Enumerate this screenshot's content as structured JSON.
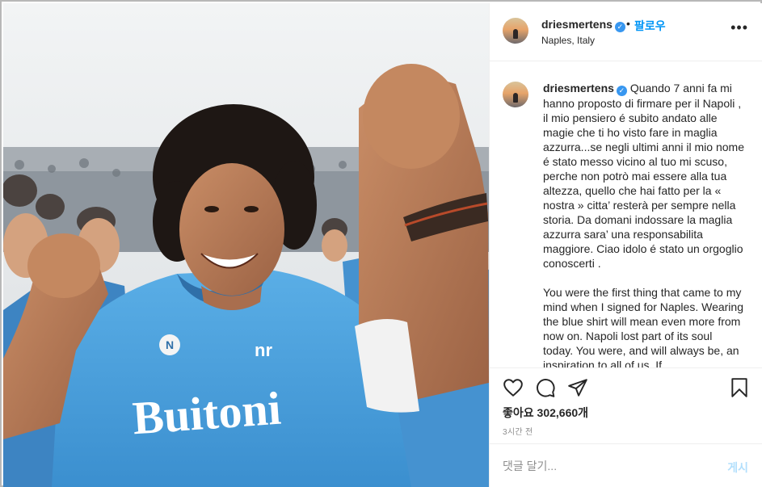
{
  "post": {
    "image_alt": "Diego Maradona celebrating in a Napoli Buitoni jersey",
    "jersey_text": "Buitoni"
  },
  "header": {
    "username": "driesmertens",
    "verified_mark": "✓",
    "dot": "•",
    "follow_label": "팔로우",
    "location": "Naples, Italy",
    "more_icon": "•••"
  },
  "caption": {
    "username": "driesmertens",
    "paragraph_1": "Quando 7 anni fa mi hanno proposto di firmare per il Napoli , il mio pensiero é subito andato alle magie che ti ho visto fare in maglia azzurra...se negli ultimi anni il mio nome é stato messo vicino al tuo mi scuso, perche non potrò mai essere alla tua altezza, quello che hai fatto per la « nostra » citta’ resterà per sempre nella storia. Da domani indossare la maglia azzurra sara’ una responsabilita maggiore. Ciao idolo é stato un orgoglio conoscerti .",
    "paragraph_2": "You were the first thing that came to my mind when I signed for Naples. Wearing the blue shirt will mean even more from now on. Napoli lost part of its soul today. You were, and will always be, an inspiration to all of us. If"
  },
  "actions": {
    "likes_label": "좋아요 302,660개",
    "time": "3시간 전"
  },
  "comment": {
    "placeholder": "댓글 달기...",
    "post_label": "게시"
  },
  "colors": {
    "accent": "#0095f6",
    "verified": "#3897f0",
    "jersey_blue": "#4a9fdc",
    "muted": "#8e8e8e"
  }
}
